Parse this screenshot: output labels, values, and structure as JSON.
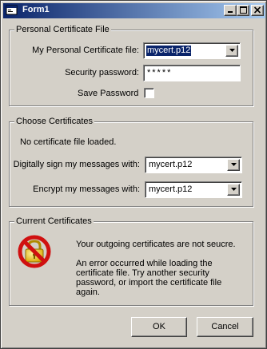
{
  "window": {
    "title": "Form1",
    "buttons": {
      "minimize": "_",
      "maximize": "□",
      "close": "×"
    }
  },
  "personal": {
    "legend": "Personal Certificate File",
    "file_label": "My Personal Certificate file:",
    "file_value": "mycert.p12",
    "password_label": "Security password:",
    "password_value": "*****",
    "save_label": "Save Password",
    "save_checked": false
  },
  "choose": {
    "legend": "Choose Certificates",
    "status": "No certificate file loaded.",
    "sign_label": "Digitally sign my messages with:",
    "sign_value": "mycert.p12",
    "encrypt_label": "Encrypt my messages with:",
    "encrypt_value": "mycert.p12"
  },
  "current": {
    "legend": "Current Certificates",
    "msg1": "Your outgoing certificates are not seucre.",
    "msg2_line1": "An error occurred while loading the",
    "msg2_line2": "certificate file. Try another security",
    "msg2_line3": "password, or import the certificate file",
    "msg2_line4": "again."
  },
  "footer": {
    "ok_label": "OK",
    "cancel_label": "Cancel"
  },
  "icons": {
    "title": "form-icon",
    "dropdown": "dropdown-arrow-icon",
    "error": "no-entry-lock-icon"
  },
  "colors": {
    "titlebar_start": "#0a246a",
    "titlebar_end": "#a6caf0",
    "selection": "#0a246a"
  }
}
